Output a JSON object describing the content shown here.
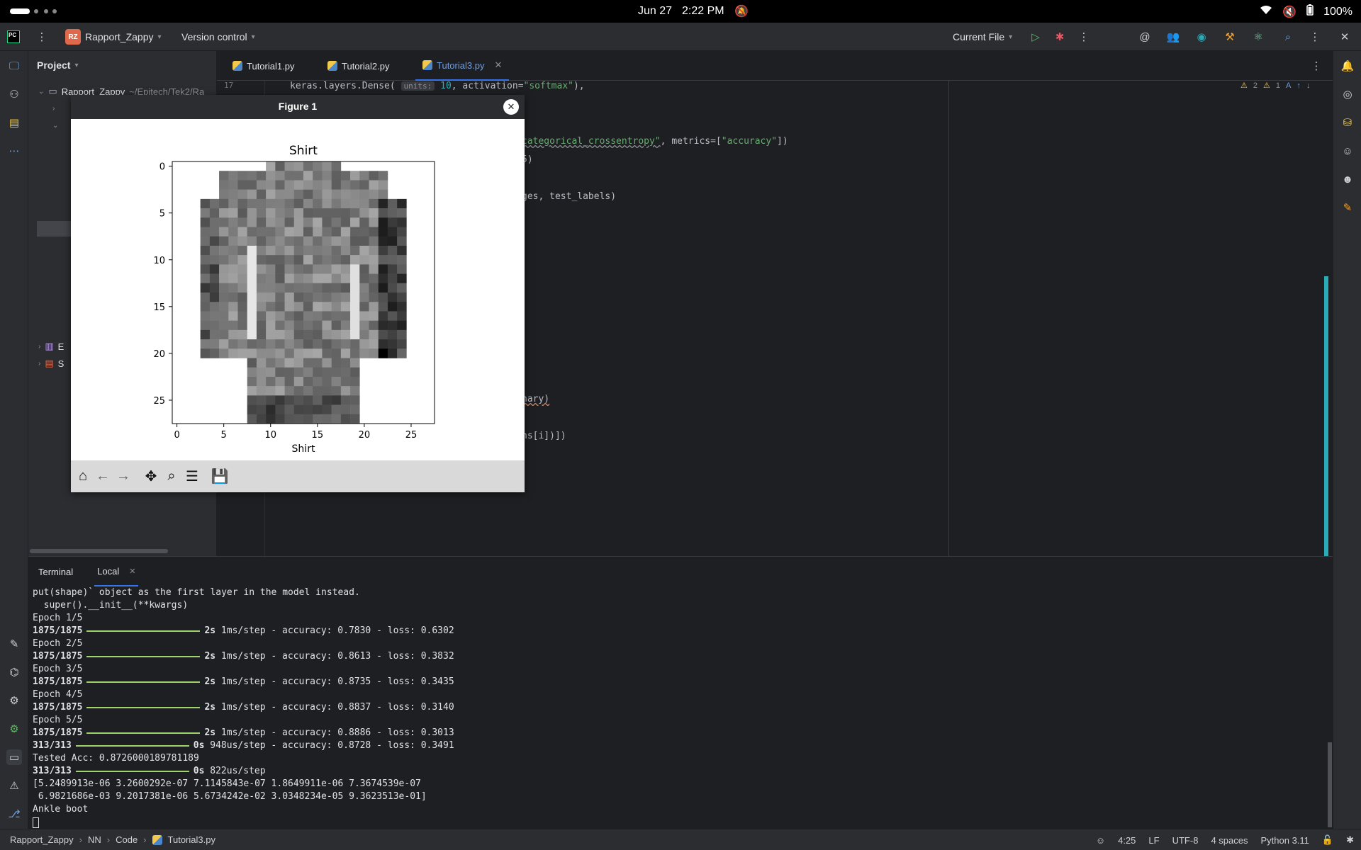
{
  "status_bar": {
    "date": "Jun 27",
    "time": "2:22 PM",
    "battery": "100%"
  },
  "toolbar": {
    "project_name": "Rapport_Zappy",
    "project_initials": "RZ",
    "version_control": "Version control",
    "run_config": "Current File"
  },
  "project_panel": {
    "title": "Project",
    "root_label": "Rapport_Zappy",
    "root_path": "~/Epitech/Tek2/Ra",
    "rows": [
      "E",
      "S"
    ]
  },
  "editor": {
    "tabs": [
      {
        "label": "Tutorial1.py"
      },
      {
        "label": "Tutorial2.py"
      },
      {
        "label": "Tutorial3.py"
      }
    ],
    "line_number": "17",
    "inlay_units": "units:",
    "line17": {
      "prefix": "keras.layers.Dense(",
      "units": "10",
      "mid": ", activation=",
      "act": "\"softmax\"",
      "end": "),"
    },
    "frag1": {
      "loss": "categorical_crossentropy\"",
      "mid": ", metrics=[",
      "acc": "\"accuracy\"",
      "end": "])"
    },
    "frag2": "5)",
    "frag3": "ges, test_labels)",
    "frag4": "nary)",
    "frag5": "ns[i])])",
    "warnings": {
      "w1": "2",
      "w2": "1"
    }
  },
  "figure": {
    "window_title": "Figure 1",
    "chart_data": {
      "type": "heatmap",
      "title": "Shirt",
      "xlabel": "Shirt",
      "ylabel": "",
      "x_ticks": [
        "0",
        "5",
        "10",
        "15",
        "20",
        "25"
      ],
      "y_ticks": [
        "0",
        "5",
        "10",
        "15",
        "20",
        "25"
      ],
      "colormap": "gray_r",
      "grid": false,
      "size": [
        28,
        28
      ]
    }
  },
  "terminal": {
    "tab_title": "Terminal",
    "session": "Local",
    "lines": [
      {
        "kind": "text",
        "text": "put(shape)` object as the first layer in the model instead."
      },
      {
        "kind": "text",
        "text": "  super().__init__(**kwargs)"
      },
      {
        "kind": "text",
        "text": "Epoch 1/5"
      },
      {
        "kind": "progress",
        "steps": "1875/1875",
        "time": "2s",
        "rest": " 1ms/step - accuracy: 0.7830 - loss: 0.6302"
      },
      {
        "kind": "text",
        "text": "Epoch 2/5"
      },
      {
        "kind": "progress",
        "steps": "1875/1875",
        "time": "2s",
        "rest": " 1ms/step - accuracy: 0.8613 - loss: 0.3832"
      },
      {
        "kind": "text",
        "text": "Epoch 3/5"
      },
      {
        "kind": "progress",
        "steps": "1875/1875",
        "time": "2s",
        "rest": " 1ms/step - accuracy: 0.8735 - loss: 0.3435"
      },
      {
        "kind": "text",
        "text": "Epoch 4/5"
      },
      {
        "kind": "progress",
        "steps": "1875/1875",
        "time": "2s",
        "rest": " 1ms/step - accuracy: 0.8837 - loss: 0.3140"
      },
      {
        "kind": "text",
        "text": "Epoch 5/5"
      },
      {
        "kind": "progress",
        "steps": "1875/1875",
        "time": "2s",
        "rest": " 1ms/step - accuracy: 0.8886 - loss: 0.3013"
      },
      {
        "kind": "progress",
        "steps": "313/313",
        "time": "0s",
        "rest": " 948us/step - accuracy: 0.8728 - loss: 0.3491"
      },
      {
        "kind": "text",
        "text": "Tested Acc: 0.8726000189781189"
      },
      {
        "kind": "progress",
        "steps": "313/313",
        "time": "0s",
        "rest": " 822us/step"
      },
      {
        "kind": "text",
        "text": "[5.2489913e-06 3.2600292e-07 7.1145843e-07 1.8649911e-06 7.3674539e-07"
      },
      {
        "kind": "text",
        "text": " 6.9821686e-03 9.2017381e-06 5.6734242e-02 3.0348234e-05 9.3623513e-01]"
      },
      {
        "kind": "text",
        "text": "Ankle boot"
      }
    ]
  },
  "bottom_status": {
    "breadcrumb": [
      "Rapport_Zappy",
      "NN",
      "Code",
      "Tutorial3.py"
    ],
    "position": "4:25",
    "line_sep": "LF",
    "encoding": "UTF-8",
    "indent": "4 spaces",
    "interpreter": "Python 3.11"
  },
  "colors": {
    "accent": "#3574f0",
    "progress": "#9fd36b",
    "project_badge": "#e1694b"
  }
}
